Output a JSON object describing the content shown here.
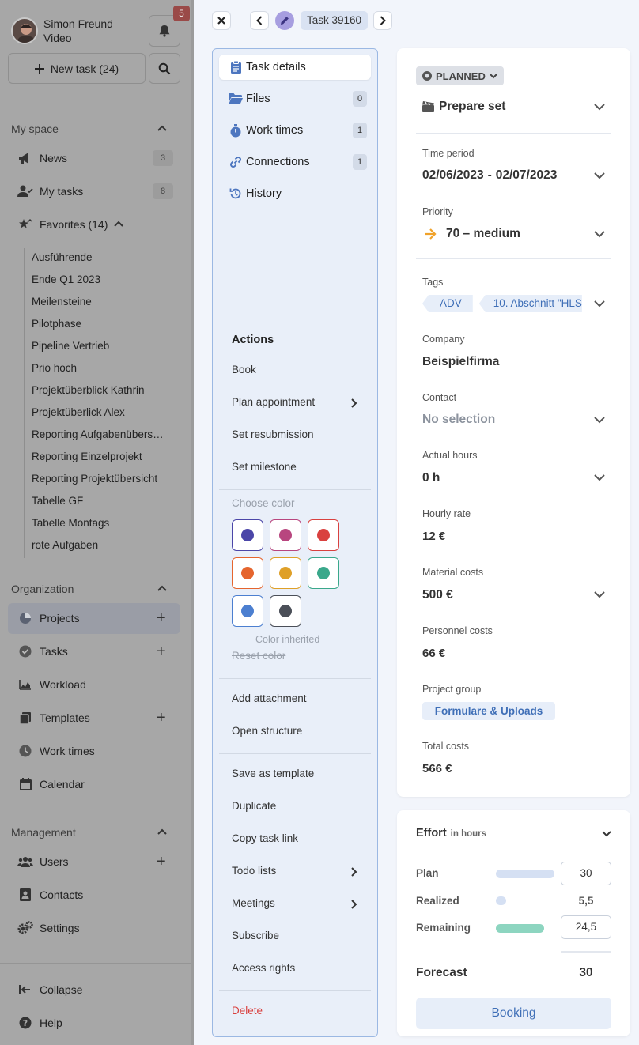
{
  "sidebar": {
    "user_name": "Simon Freund",
    "user_role": "Video",
    "notification_count": "5",
    "new_task_label": "New task (24)",
    "my_space": {
      "title": "My space",
      "items": [
        {
          "label": "News",
          "count": "3"
        },
        {
          "label": "My tasks",
          "count": "8"
        },
        {
          "label": "Favorites (14)"
        }
      ]
    },
    "favorites": [
      "Ausführende",
      "Ende Q1 2023",
      "Meilensteine",
      "Pilotphase",
      "Pipeline Vertrieb",
      "Prio hoch",
      "Projektüberblick Kathrin",
      "Projektüberlick Alex",
      "Reporting Aufgabenübers…",
      "Reporting Einzelprojekt",
      "Reporting Projektübersicht",
      "Tabelle GF",
      "Tabelle Montags",
      "rote Aufgaben"
    ],
    "organization": {
      "title": "Organization",
      "items": [
        {
          "label": "Projects"
        },
        {
          "label": "Tasks"
        },
        {
          "label": "Workload"
        },
        {
          "label": "Templates"
        },
        {
          "label": "Work times"
        },
        {
          "label": "Calendar"
        }
      ]
    },
    "management": {
      "title": "Management",
      "items": [
        {
          "label": "Users"
        },
        {
          "label": "Contacts"
        },
        {
          "label": "Settings"
        }
      ]
    },
    "collapse_label": "Collapse",
    "help_label": "Help"
  },
  "topbar": {
    "task_label": "Task 39160"
  },
  "task_tabs": [
    {
      "label": "Task details"
    },
    {
      "label": "Files",
      "count": "0"
    },
    {
      "label": "Work times",
      "count": "1"
    },
    {
      "label": "Connections",
      "count": "1"
    },
    {
      "label": "History"
    }
  ],
  "actions": {
    "title": "Actions",
    "book": "Book",
    "plan_appointment": "Plan appointment",
    "set_resubmission": "Set resubmission",
    "set_milestone": "Set milestone",
    "choose_color": "Choose color",
    "color_inherited": "Color inherited",
    "reset_color": "Reset color",
    "add_attachment": "Add attachment",
    "open_structure": "Open structure",
    "save_as_template": "Save as template",
    "duplicate": "Duplicate",
    "copy_task_link": "Copy task link",
    "todo_lists": "Todo lists",
    "meetings": "Meetings",
    "subscribe": "Subscribe",
    "access_rights": "Access rights",
    "delete": "Delete"
  },
  "colors": {
    "swatches": [
      "#4b46a8",
      "#b8467f",
      "#d9413f",
      "#e5652e",
      "#dfa028",
      "#3aa88b",
      "#4c7fd0",
      "#4b4f58"
    ],
    "accent": "#3f6fb7",
    "delete": "#d9413f",
    "priority_arrow": "#f0a22a"
  },
  "details": {
    "status": "PLANNED",
    "task_title": "Prepare set",
    "time_period_label": "Time period",
    "time_period_start": "02/06/2023",
    "time_period_sep": "-",
    "time_period_end": "02/07/2023",
    "priority_label": "Priority",
    "priority_value": "70 – medium",
    "tags_label": "Tags",
    "tags": [
      "ADV",
      "10. Abschnitt \"HLS"
    ],
    "company_label": "Company",
    "company_value": "Beispielfirma",
    "contact_label": "Contact",
    "contact_value": "No selection",
    "actual_hours_label": "Actual hours",
    "actual_hours_value": "0 h",
    "hourly_rate_label": "Hourly rate",
    "hourly_rate_value": "12 €",
    "material_costs_label": "Material costs",
    "material_costs_value": "500 €",
    "personnel_costs_label": "Personnel costs",
    "personnel_costs_value": "66 €",
    "project_group_label": "Project group",
    "project_group_value": "Formulare & Uploads",
    "total_costs_label": "Total costs",
    "total_costs_value": "566 €"
  },
  "effort": {
    "title": "Effort",
    "unit": "in hours",
    "plan_label": "Plan",
    "plan_value": "30",
    "realized_label": "Realized",
    "realized_value": "5,5",
    "remaining_label": "Remaining",
    "remaining_value": "24,5",
    "forecast_label": "Forecast",
    "forecast_value": "30",
    "booking_label": "Booking"
  }
}
